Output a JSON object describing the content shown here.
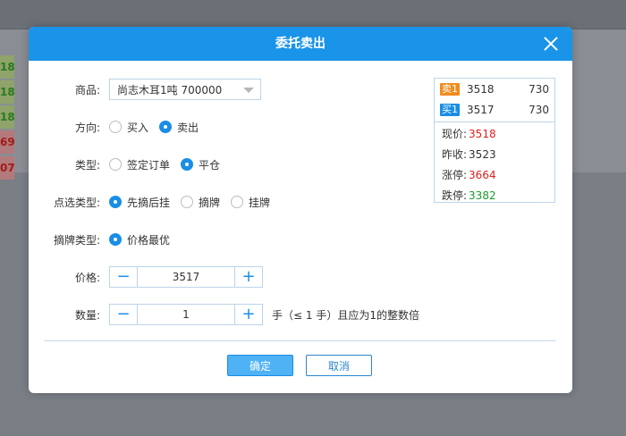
{
  "background": {
    "cells": [
      {
        "text": "18",
        "tone": "green"
      },
      {
        "text": "18",
        "tone": "green"
      },
      {
        "text": "18",
        "tone": "green"
      },
      {
        "text": "69",
        "tone": "red"
      },
      {
        "text": "07",
        "tone": "red"
      }
    ]
  },
  "dialog": {
    "title": "委托卖出",
    "product": {
      "label": "商品:",
      "value": "尚志木耳1吨 700000"
    },
    "direction": {
      "label": "方向:",
      "options": [
        "买入",
        "卖出"
      ],
      "selected": "卖出"
    },
    "type": {
      "label": "类型:",
      "options": [
        "签定订单",
        "平仓"
      ],
      "selected": "平仓"
    },
    "pick_type": {
      "label": "点选类型:",
      "options": [
        "先摘后挂",
        "摘牌",
        "挂牌"
      ],
      "selected": "先摘后挂"
    },
    "delist_type": {
      "label": "摘牌类型:",
      "options": [
        "价格最优"
      ],
      "selected": "价格最优"
    },
    "price": {
      "label": "价格:",
      "value": "3517"
    },
    "quantity": {
      "label": "数量:",
      "value": "1",
      "note": "手（≤ 1 手）且应为1的整数倍"
    },
    "buttons": {
      "ok": "确定",
      "cancel": "取消"
    }
  },
  "quote": {
    "ask": {
      "badge": "卖1",
      "price": "3518",
      "volume": "730"
    },
    "bid": {
      "badge": "买1",
      "price": "3517",
      "volume": "730"
    },
    "current": {
      "label": "现价:",
      "value": "3518"
    },
    "prev_close": {
      "label": "昨收:",
      "value": "3523"
    },
    "limit_up": {
      "label": "涨停:",
      "value": "3664"
    },
    "limit_down": {
      "label": "跌停:",
      "value": "3382"
    }
  },
  "colors": {
    "header": "#1a94e8",
    "accent": "#1a8ee6",
    "sell_badge": "#f08c1e",
    "up": "#e02020",
    "down": "#1a9b2a"
  }
}
